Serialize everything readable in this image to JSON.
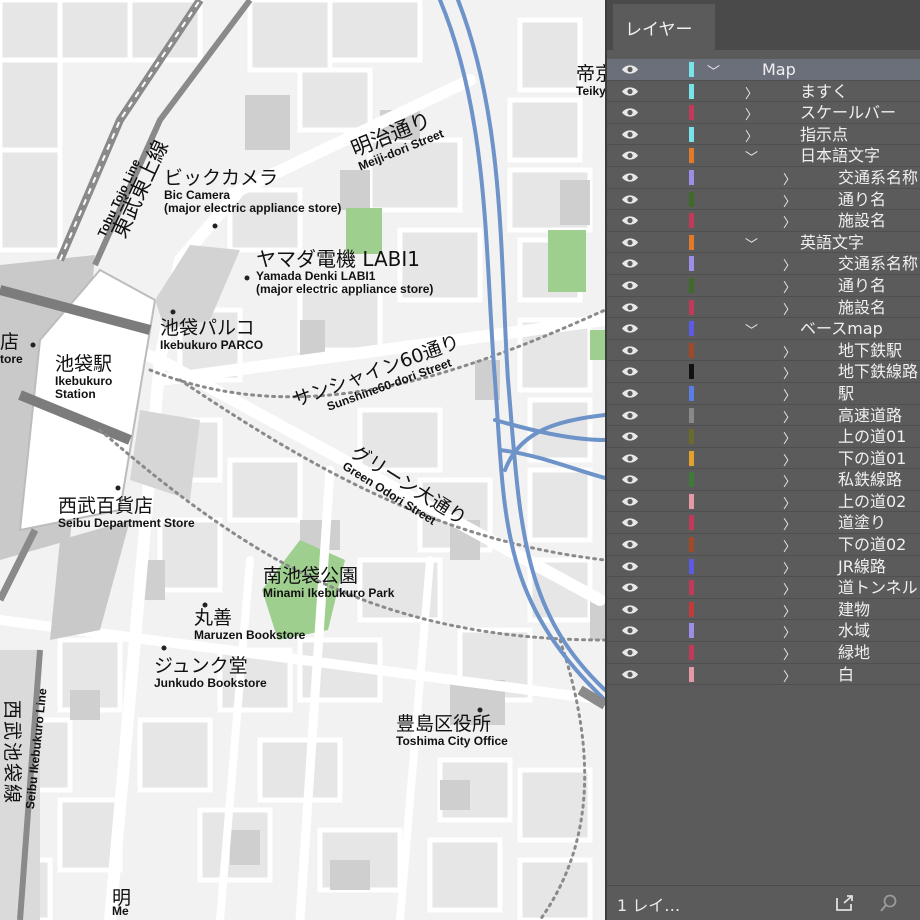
{
  "map": {
    "labels": [
      {
        "jp": "東武東上線",
        "en": "Tobu Tojo Line"
      },
      {
        "jp": "ビックカメラ",
        "en": "Bic Camera",
        "en2": "(major electric appliance store)"
      },
      {
        "jp": "明治通り",
        "en": "Meiji-dori Street"
      },
      {
        "jp": "ヤマダ電機 LABI1",
        "en": "Yamada Denki LABI1",
        "en2": "(major electric appliance store)"
      },
      {
        "jp": "池袋パルコ",
        "en": "Ikebukuro PARCO"
      },
      {
        "jp": "池袋駅",
        "en": "Ikebukuro",
        "en2": "Station"
      },
      {
        "jp": "サンシャイン60通り",
        "en": "Sunshine60-dori Street"
      },
      {
        "jp": "グリーン大通り",
        "en": "Green Odori Street"
      },
      {
        "jp": "西武百貨店",
        "en": "Seibu Department Store"
      },
      {
        "jp": "南池袋公園",
        "en": "Minami Ikebukuro Park"
      },
      {
        "jp": "丸善",
        "en": "Maruzen Bookstore"
      },
      {
        "jp": "ジュンク堂",
        "en": "Junkudo Bookstore"
      },
      {
        "jp": "豊島区役所",
        "en": "Toshima City Office"
      },
      {
        "jp": "西武池袋線",
        "en": "Seibu Ikebukuro Line"
      },
      {
        "jp": "帝京",
        "en": "Teiky"
      },
      {
        "jp": "店",
        "en": "tore"
      },
      {
        "jp": "明",
        "en": "Me"
      }
    ]
  },
  "panel": {
    "tab_label": "レイヤー",
    "footer_label": "1 レイ…",
    "layers": [
      {
        "name": "Map",
        "color": "#79e3ea",
        "depth": 0,
        "expanded": true,
        "selected": true
      },
      {
        "name": "ますく",
        "color": "#79e3ea",
        "depth": 1,
        "expanded": false
      },
      {
        "name": "スケールバー",
        "color": "#c23a5a",
        "depth": 1,
        "expanded": false
      },
      {
        "name": "指示点",
        "color": "#79e3ea",
        "depth": 1,
        "expanded": false
      },
      {
        "name": "日本語文字",
        "color": "#e37a2a",
        "depth": 1,
        "expanded": true
      },
      {
        "name": "交通系名称",
        "color": "#9b8ee6",
        "depth": 2,
        "expanded": false
      },
      {
        "name": "通り名",
        "color": "#3f6a2a",
        "depth": 2,
        "expanded": false
      },
      {
        "name": "施設名",
        "color": "#c23a5a",
        "depth": 2,
        "expanded": false
      },
      {
        "name": "英語文字",
        "color": "#e37a2a",
        "depth": 1,
        "expanded": true
      },
      {
        "name": "交通系名称",
        "color": "#9b8ee6",
        "depth": 2,
        "expanded": false
      },
      {
        "name": "通り名",
        "color": "#3f6a2a",
        "depth": 2,
        "expanded": false
      },
      {
        "name": "施設名",
        "color": "#c23a5a",
        "depth": 2,
        "expanded": false
      },
      {
        "name": "ベースmap",
        "color": "#5b5be6",
        "depth": 1,
        "expanded": true
      },
      {
        "name": "地下鉄駅",
        "color": "#a04a2a",
        "depth": 2,
        "expanded": false
      },
      {
        "name": "地下鉄線路",
        "color": "#111111",
        "depth": 2,
        "expanded": false
      },
      {
        "name": "駅",
        "color": "#5b7ee6",
        "depth": 2,
        "expanded": false
      },
      {
        "name": "高速道路",
        "color": "#888888",
        "depth": 2,
        "expanded": false
      },
      {
        "name": "上の道01",
        "color": "#6a6a2a",
        "depth": 2,
        "expanded": false
      },
      {
        "name": "下の道01",
        "color": "#e3a02a",
        "depth": 2,
        "expanded": false
      },
      {
        "name": "私鉄線路",
        "color": "#3f7a3a",
        "depth": 2,
        "expanded": false
      },
      {
        "name": "上の道02",
        "color": "#e39aa6",
        "depth": 2,
        "expanded": false
      },
      {
        "name": "道塗り",
        "color": "#c23a5a",
        "depth": 2,
        "expanded": false
      },
      {
        "name": "下の道02",
        "color": "#a04a2a",
        "depth": 2,
        "expanded": false
      },
      {
        "name": "JR線路",
        "color": "#5b5be6",
        "depth": 2,
        "expanded": false
      },
      {
        "name": "道トンネル",
        "color": "#c23a5a",
        "depth": 2,
        "expanded": false
      },
      {
        "name": "建物",
        "color": "#c23a3a",
        "depth": 2,
        "expanded": false
      },
      {
        "name": "水域",
        "color": "#9b8ee6",
        "depth": 2,
        "expanded": false
      },
      {
        "name": "緑地",
        "color": "#c23a5a",
        "depth": 2,
        "expanded": false
      },
      {
        "name": "白",
        "color": "#e39aa6",
        "depth": 2,
        "expanded": false
      }
    ]
  }
}
